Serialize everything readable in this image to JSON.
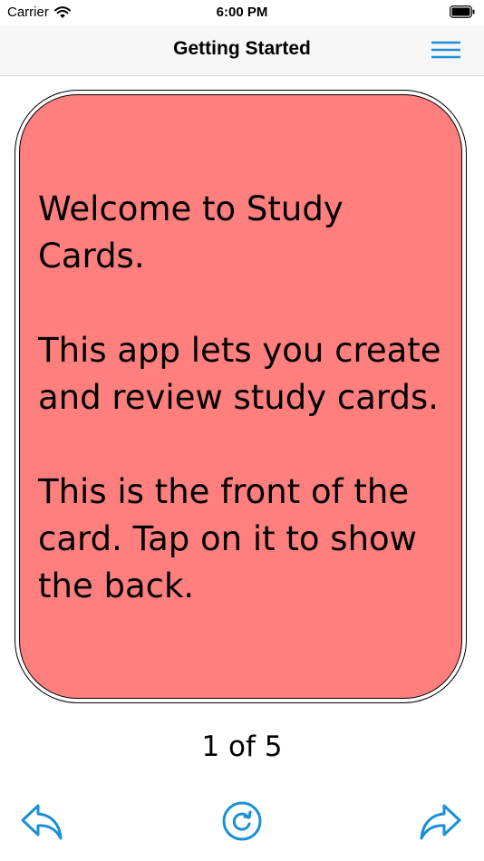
{
  "status_bar": {
    "carrier": "Carrier",
    "time": "6:00 PM"
  },
  "nav": {
    "title": "Getting Started"
  },
  "card": {
    "paragraphs": [
      "Welcome to Study Cards.",
      "This app lets you create and review study cards.",
      "This is the front of the card. Tap on it to show the back."
    ],
    "color": "#ff7e7e"
  },
  "counter": "1 of 5",
  "accent_color": "#1a8fd6",
  "icons": {
    "menu": "hamburger-icon",
    "back": "reply-arrow-left-icon",
    "flip": "rotate-icon",
    "forward": "share-arrow-right-icon"
  }
}
